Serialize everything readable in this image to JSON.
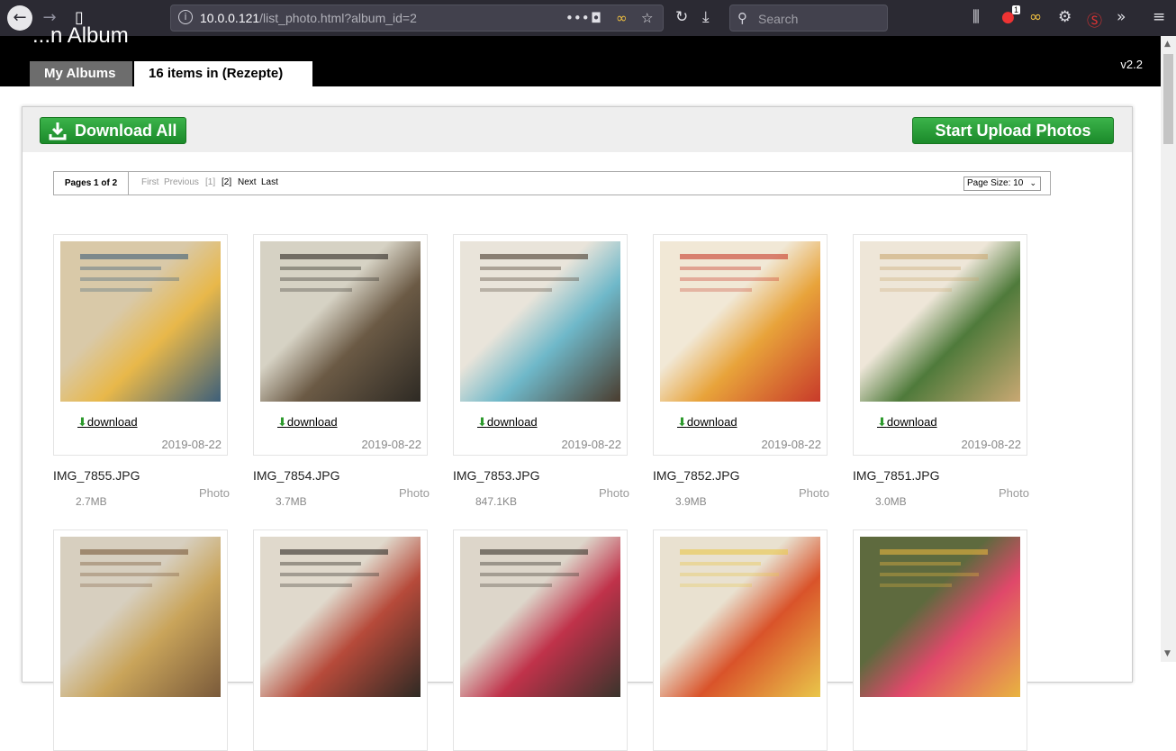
{
  "browser": {
    "url_host": "10.0.0.121",
    "url_path": "/list_photo.html?album_id=2",
    "search_placeholder": "Search",
    "badge_count": "1"
  },
  "header": {
    "title_cut": "...n Album",
    "tab_my_albums": "My Albums",
    "tab_current": "16 items in (Rezepte)",
    "version": "v2.2"
  },
  "actions": {
    "download_all": "Download All",
    "start_upload": "Start Upload Photos"
  },
  "pager": {
    "pages": "Pages 1 of 2",
    "first": "First",
    "previous": "Previous",
    "page1": "[1]",
    "page2": "[2]",
    "next": "Next",
    "last": "Last",
    "page_size": "Page Size: 10"
  },
  "photos": [
    {
      "name": "IMG_7855.JPG",
      "date": "2019-08-22",
      "size": "2.7MB",
      "type": "Photo",
      "download": "download",
      "palette": [
        "#d9c9a8",
        "#e8b84a",
        "#3d5f7a"
      ]
    },
    {
      "name": "IMG_7854.JPG",
      "date": "2019-08-22",
      "size": "3.7MB",
      "type": "Photo",
      "download": "download",
      "palette": [
        "#d6d2c4",
        "#6b5a45",
        "#2e2a24"
      ]
    },
    {
      "name": "IMG_7853.JPG",
      "date": "2019-08-22",
      "size": "847.1KB",
      "type": "Photo",
      "download": "download",
      "palette": [
        "#e9e4da",
        "#6fb8c9",
        "#4a3c2e"
      ]
    },
    {
      "name": "IMG_7852.JPG",
      "date": "2019-08-22",
      "size": "3.9MB",
      "type": "Photo",
      "download": "download",
      "palette": [
        "#f1e8d6",
        "#e8a33a",
        "#c83a2a"
      ]
    },
    {
      "name": "IMG_7851.JPG",
      "date": "2019-08-22",
      "size": "3.0MB",
      "type": "Photo",
      "download": "download",
      "palette": [
        "#eee6d8",
        "#4f7a3b",
        "#c9a873"
      ]
    },
    {
      "palette": [
        "#d7cfbf",
        "#c9a45a",
        "#7a5a3a"
      ]
    },
    {
      "palette": [
        "#e0d9cc",
        "#b64a3a",
        "#2f2a24"
      ]
    },
    {
      "palette": [
        "#ddd6ca",
        "#c0324a",
        "#3a342c"
      ]
    },
    {
      "palette": [
        "#e9e1d0",
        "#d9532a",
        "#e9c64a"
      ]
    },
    {
      "palette": [
        "#5e6a3e",
        "#e0486a",
        "#e8b440"
      ]
    }
  ]
}
